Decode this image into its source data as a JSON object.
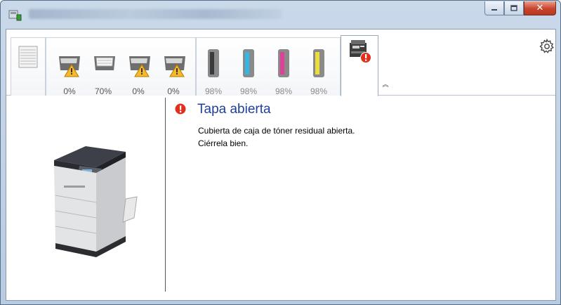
{
  "window": {
    "title": "",
    "app_icon": "printer-status-icon",
    "buttons": {
      "minimize": "minimize-icon",
      "maximize": "maximize-icon",
      "close_glyph": "✕"
    }
  },
  "tabs": {
    "paper_tab_icon": "paper-stack-icon",
    "trays": [
      {
        "icon": "paper-tray-warning-icon",
        "level": "0%"
      },
      {
        "icon": "paper-tray-icon",
        "level": "70%"
      },
      {
        "icon": "paper-tray-warning-icon",
        "level": "0%"
      },
      {
        "icon": "paper-tray-warning-icon",
        "level": "0%"
      }
    ],
    "toners": [
      {
        "name": "black",
        "color": "#3a3a3a",
        "level": "98%"
      },
      {
        "name": "cyan",
        "color": "#34b6e6",
        "level": "98%"
      },
      {
        "name": "magenta",
        "color": "#e0409a",
        "level": "98%"
      },
      {
        "name": "yellow",
        "color": "#eedc3a",
        "level": "98%"
      }
    ],
    "device_tab_icon": "device-error-icon",
    "collapse_glyph": "︽",
    "settings_icon": "gear-icon"
  },
  "status": {
    "title": "Tapa abierta",
    "line1": "Cubierta de caja de tóner residual abierta.",
    "line2": "Ciérrela bien.",
    "error_color": "#e0301e"
  }
}
